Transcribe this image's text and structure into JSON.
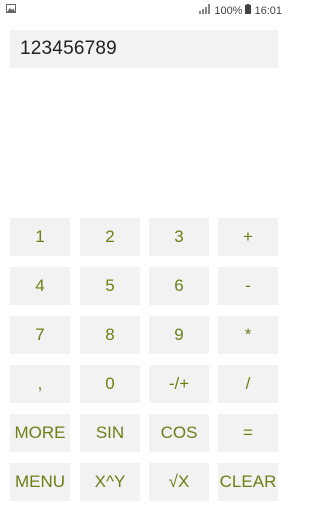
{
  "status_bar": {
    "battery_percent": "100%",
    "time": "16:01",
    "icons": [
      "image-icon",
      "signal-icon",
      "battery-icon"
    ]
  },
  "display": {
    "value": "123456789"
  },
  "keys": [
    [
      "1",
      "2",
      "3",
      "+"
    ],
    [
      "4",
      "5",
      "6",
      "-"
    ],
    [
      "7",
      "8",
      "9",
      "*"
    ],
    [
      ",",
      "0",
      "-/+",
      "/"
    ],
    [
      "MORE",
      "SIN",
      "COS",
      "="
    ],
    [
      "MENU",
      "X^Y",
      "√X",
      "CLEAR"
    ]
  ],
  "colors": {
    "key_text": "#6b8016",
    "key_background": "#f2f2f2",
    "display_background": "#f2f2f2",
    "display_text": "#222222"
  }
}
